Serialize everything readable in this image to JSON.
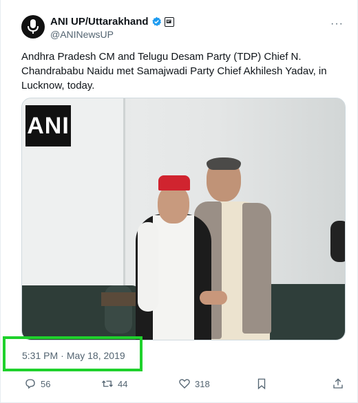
{
  "author": {
    "name": "ANI UP/Uttarakhand",
    "handle": "@ANINewsUP",
    "avatar_icon": "ani-mic-logo-icon",
    "verified_icon": "verified-badge-icon",
    "affiliate_icon": "news-affiliate-icon"
  },
  "more_label": "···",
  "tweet_text": "Andhra Pradesh CM and Telugu Desam Party (TDP) Chief N. Chandrababu Naidu met Samajwadi Party Chief Akhilesh Yadav, in Lucknow, today.",
  "media": {
    "watermark": "ANI"
  },
  "timestamp": {
    "time": "5:31 PM",
    "separator": "·",
    "date": "May 18, 2019"
  },
  "actions": {
    "replies": "56",
    "reposts": "44",
    "likes": "318"
  },
  "colors": {
    "text": "#0f1419",
    "secondary": "#536471",
    "verified": "#1d9bf0",
    "highlight": "#1fd12c"
  }
}
